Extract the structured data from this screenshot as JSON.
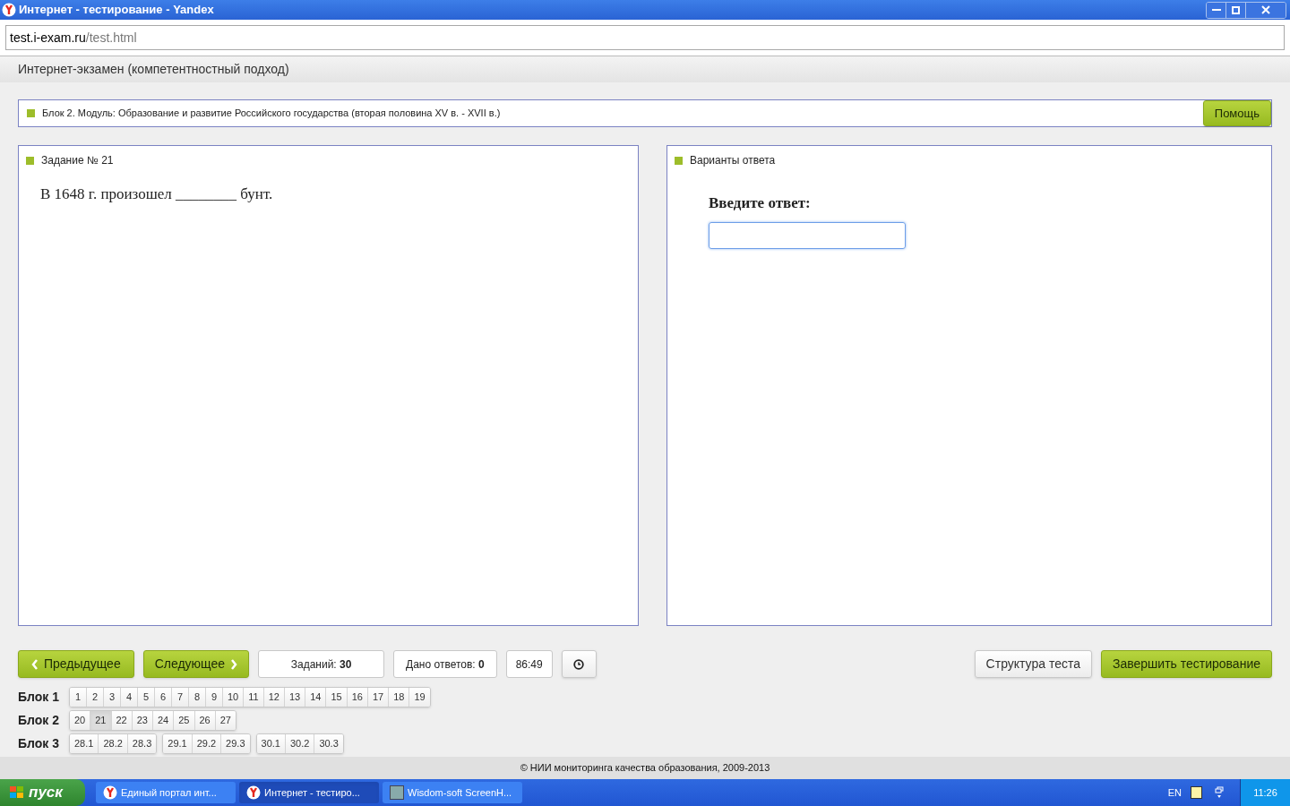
{
  "window": {
    "title": "Интернет - тестирование - Yandex"
  },
  "address": {
    "host": "test.i-exam.ru",
    "path": "/test.html"
  },
  "page_header": "Интернет-экзамен (компетентностный подход)",
  "module_bar": {
    "text": "Блок 2. Модуль: Образование и развитие Российского государства (вторая половина XV в. - XVII в.)",
    "help_button": "Помощь"
  },
  "task_panel": {
    "title": "Задание № 21",
    "question": "В 1648 г. произошел ________ бунт."
  },
  "answer_panel": {
    "title": "Варианты ответа",
    "prompt": "Введите ответ:"
  },
  "controls": {
    "prev": "Предыдущее",
    "next": "Следующее",
    "tasks_label": "Заданий:",
    "tasks_value": "30",
    "answers_label": "Дано ответов:",
    "answers_value": "0",
    "timer": "86:49",
    "structure": "Структура теста",
    "finish": "Завершить тестирование"
  },
  "blocks": [
    {
      "label": "Блок 1",
      "groups": [
        [
          {
            "label": "1",
            "selected": false
          },
          {
            "label": "2",
            "selected": false
          },
          {
            "label": "3",
            "selected": false
          },
          {
            "label": "4",
            "selected": false
          },
          {
            "label": "5",
            "selected": false
          },
          {
            "label": "6",
            "selected": false
          },
          {
            "label": "7",
            "selected": false
          },
          {
            "label": "8",
            "selected": false
          },
          {
            "label": "9",
            "selected": false
          },
          {
            "label": "10",
            "selected": false
          },
          {
            "label": "11",
            "selected": false
          },
          {
            "label": "12",
            "selected": false
          },
          {
            "label": "13",
            "selected": false
          },
          {
            "label": "14",
            "selected": false
          },
          {
            "label": "15",
            "selected": false
          },
          {
            "label": "16",
            "selected": false
          },
          {
            "label": "17",
            "selected": false
          },
          {
            "label": "18",
            "selected": false
          },
          {
            "label": "19",
            "selected": false
          }
        ]
      ]
    },
    {
      "label": "Блок 2",
      "groups": [
        [
          {
            "label": "20",
            "selected": false
          },
          {
            "label": "21",
            "selected": true
          },
          {
            "label": "22",
            "selected": false
          },
          {
            "label": "23",
            "selected": false
          },
          {
            "label": "24",
            "selected": false
          },
          {
            "label": "25",
            "selected": false
          },
          {
            "label": "26",
            "selected": false
          },
          {
            "label": "27",
            "selected": false
          }
        ]
      ]
    },
    {
      "label": "Блок 3",
      "groups": [
        [
          {
            "label": "28.1",
            "selected": false
          },
          {
            "label": "28.2",
            "selected": false
          },
          {
            "label": "28.3",
            "selected": false
          }
        ],
        [
          {
            "label": "29.1",
            "selected": false
          },
          {
            "label": "29.2",
            "selected": false
          },
          {
            "label": "29.3",
            "selected": false
          }
        ],
        [
          {
            "label": "30.1",
            "selected": false
          },
          {
            "label": "30.2",
            "selected": false
          },
          {
            "label": "30.3",
            "selected": false
          }
        ]
      ]
    }
  ],
  "footer": "© НИИ мониторинга качества образования, 2009-2013",
  "taskbar": {
    "start": "пуск",
    "items": [
      {
        "label": "Единый портал инт...",
        "kind": "browser",
        "selected": false
      },
      {
        "label": "Интернет - тестиро...",
        "kind": "browser",
        "selected": true
      },
      {
        "label": "Wisdom-soft ScreenH...",
        "kind": "app",
        "selected": false
      }
    ],
    "lang": "EN",
    "clock": "11:26"
  }
}
